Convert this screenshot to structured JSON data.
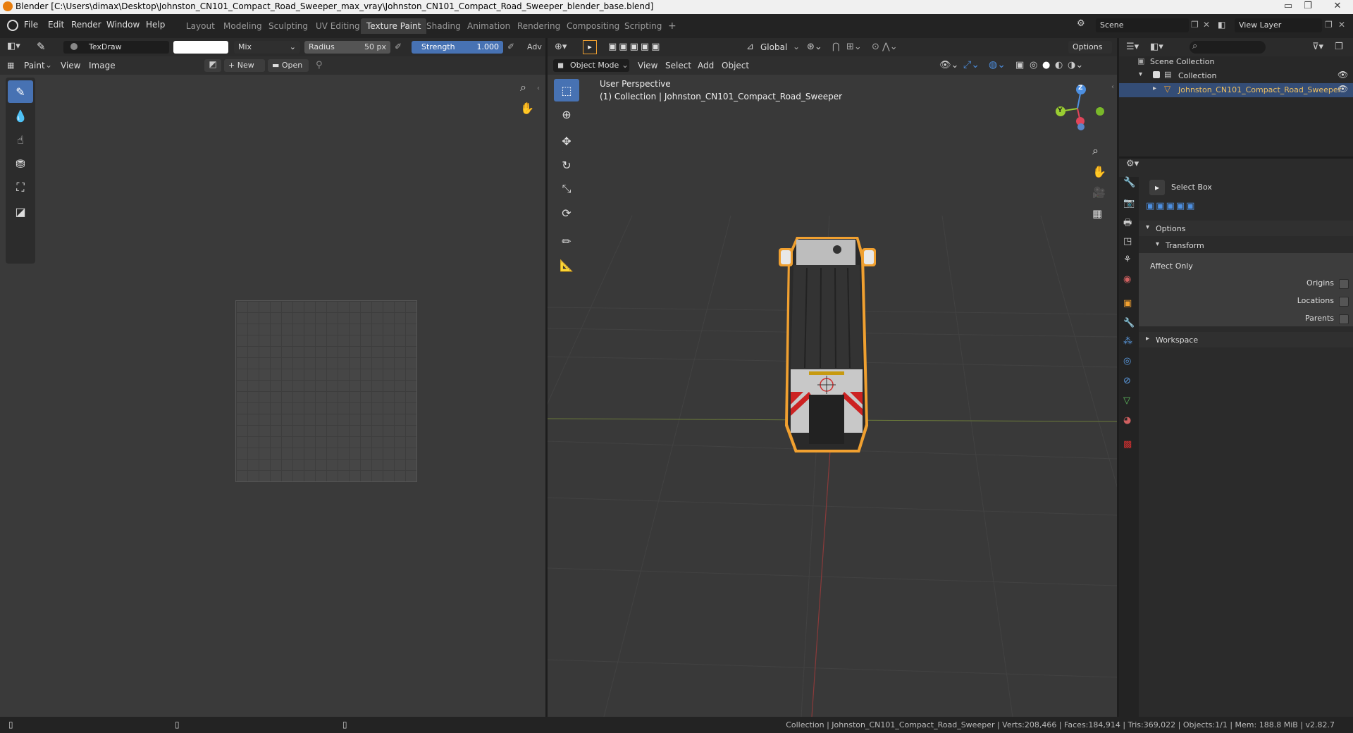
{
  "window": {
    "title": "Blender [C:\\Users\\dimax\\Desktop\\Johnston_CN101_Compact_Road_Sweeper_max_vray\\Johnston_CN101_Compact_Road_Sweeper_blender_base.blend]",
    "minimize": "▭",
    "maximize": "❐",
    "close": "✕"
  },
  "menu": [
    "File",
    "Edit",
    "Render",
    "Window",
    "Help"
  ],
  "workspaces": [
    "Layout",
    "Modeling",
    "Sculpting",
    "UV Editing",
    "Texture Paint",
    "Shading",
    "Animation",
    "Rendering",
    "Compositing",
    "Scripting",
    "+"
  ],
  "scene": {
    "label": "Scene",
    "view_layer": "View Layer"
  },
  "paint_header": {
    "brush_name": "TexDraw",
    "blend": "Mix",
    "radius_label": "Radius",
    "radius_value": "50 px",
    "strength_label": "Strength",
    "strength_value": "1.000",
    "adv": "Adv"
  },
  "image_editor": {
    "mode": "Paint",
    "menus": [
      "View",
      "Image"
    ],
    "new_label": "New",
    "open_label": "Open"
  },
  "viewport": {
    "mode": "Object Mode",
    "menus": [
      "View",
      "Select",
      "Add",
      "Object"
    ],
    "orientation": "Global",
    "options": "Options",
    "perspective": "User Perspective",
    "collection_info": "(1) Collection | Johnston_CN101_Compact_Road_Sweeper",
    "axis_z": "Z",
    "axis_y": "Y"
  },
  "outliner": {
    "scene_collection": "Scene Collection",
    "collection": "Collection",
    "object": "Johnston_CN101_Compact_Road_Sweeper"
  },
  "properties": {
    "tool_name": "Select Box",
    "options": "Options",
    "transform": "Transform",
    "affect_only": "Affect Only",
    "origins": "Origins",
    "locations": "Locations",
    "parents": "Parents",
    "workspace": "Workspace"
  },
  "statusbar": {
    "text": "Collection | Johnston_CN101_Compact_Road_Sweeper | Verts:208,466 | Faces:184,914 | Tris:369,022 | Objects:1/1 | Mem: 188.8 MiB | v2.82.7"
  },
  "colors": {
    "accent": "#4772b3",
    "selection": "#f0a030",
    "bg": "#3a3a3a"
  }
}
